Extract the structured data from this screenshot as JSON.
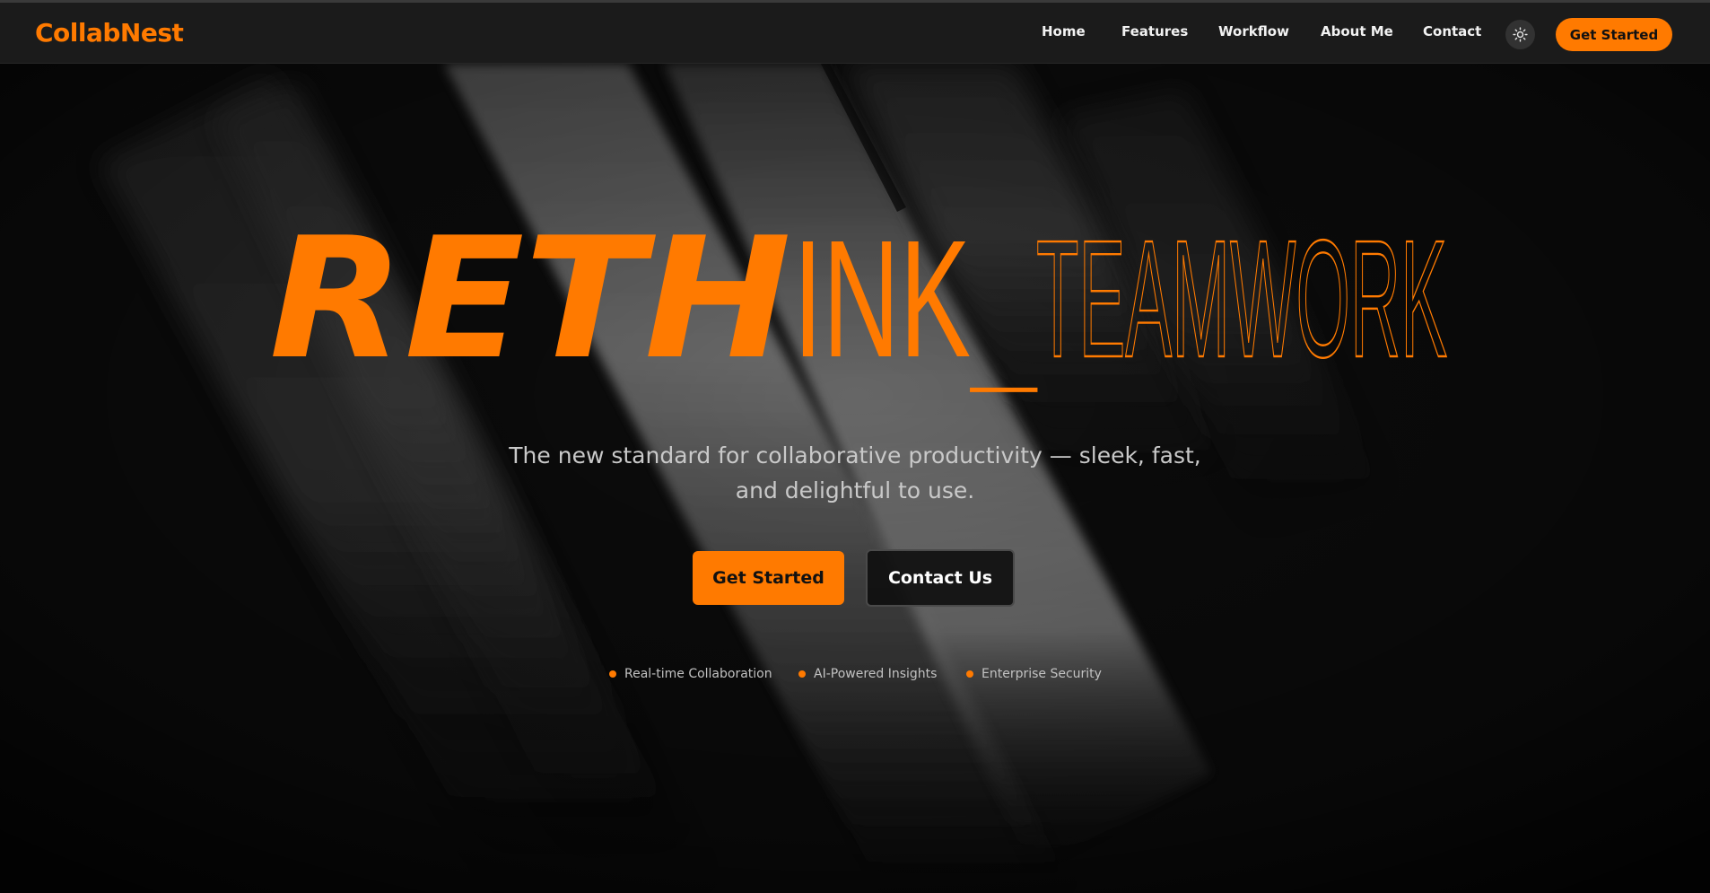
{
  "brand": {
    "name": "CollabNest"
  },
  "nav": {
    "links": [
      {
        "label": "Home"
      },
      {
        "label": "Features"
      },
      {
        "label": "Workflow"
      },
      {
        "label": "About Me"
      },
      {
        "label": "Contact"
      }
    ],
    "theme_toggle_icon": "sun-icon",
    "cta_label": "Get Started"
  },
  "hero": {
    "headline_bold": "RETH",
    "headline_condensed": "INK",
    "headline_separator": "_",
    "headline_thin": "TEAMWORK",
    "subtitle": "The new standard for collaborative productivity — sleek, fast, and delightful to use.",
    "primary_button": "Get Started",
    "secondary_button": "Contact Us",
    "features": [
      {
        "label": "Real-time Collaboration"
      },
      {
        "label": "AI-Powered Insights"
      },
      {
        "label": "Enterprise Security"
      }
    ]
  },
  "colors": {
    "accent": "#ff7a00",
    "navbar_bg": "#1b1b1b",
    "page_bg": "#0c0c0c",
    "text_primary": "#f2f2f2",
    "text_muted": "#c9c9c9"
  }
}
